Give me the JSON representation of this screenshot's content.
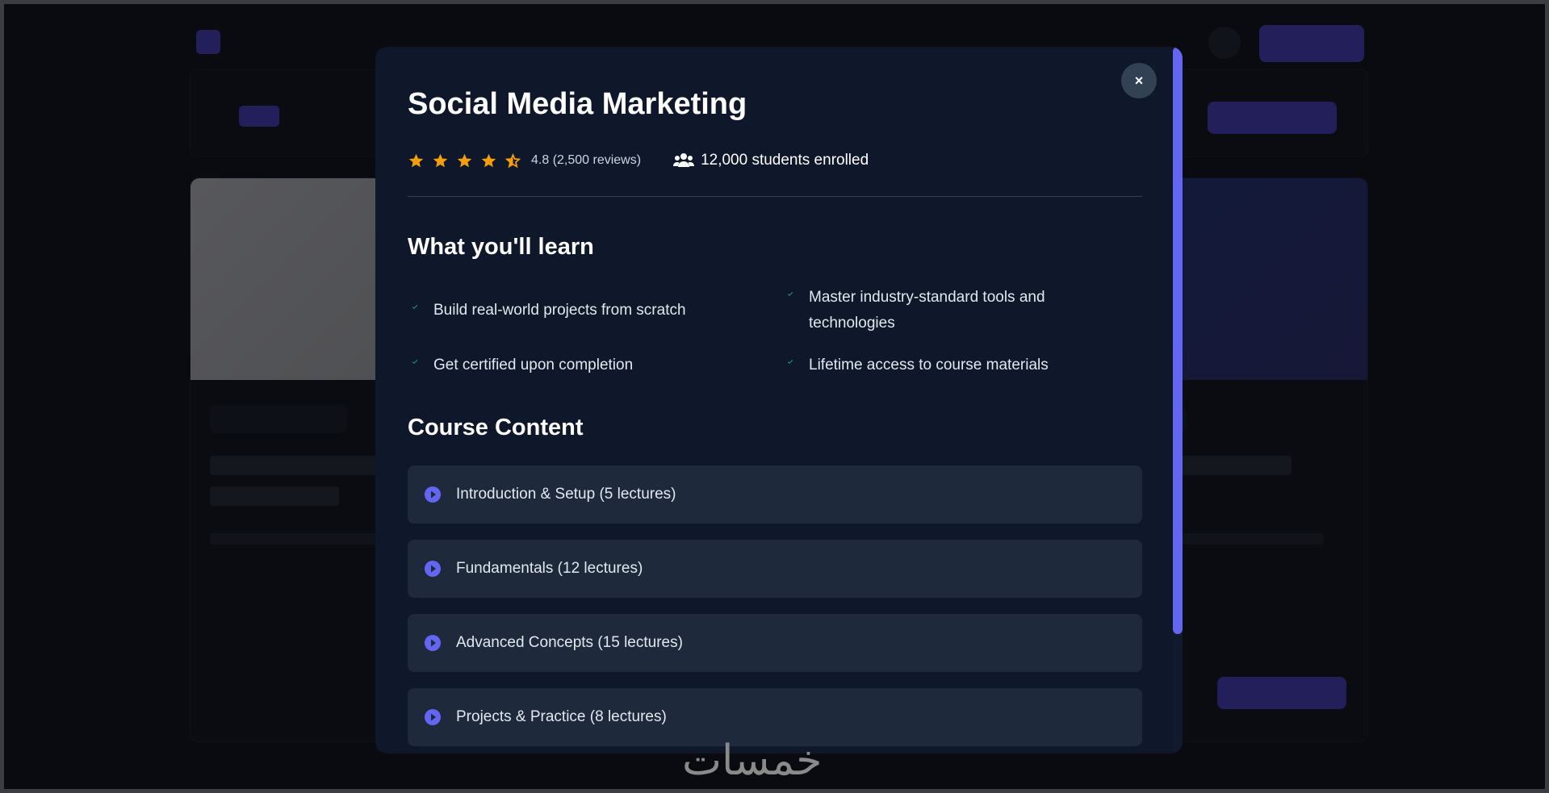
{
  "background": {
    "nav_items": [
      "",
      "",
      "",
      "",
      ""
    ]
  },
  "modal": {
    "title": "Social Media Marketing",
    "rating": {
      "value": 4.8,
      "text": "4.8 (2,500 reviews)",
      "stars_full": 4,
      "stars_half": 1,
      "star_color": "#f59e0b"
    },
    "students_text": "12,000 students enrolled",
    "learn_heading": "What you'll learn",
    "learn_items": [
      "Build real-world projects from scratch",
      "Master industry-standard tools and technologies",
      "Get certified upon completion",
      "Lifetime access to course materials"
    ],
    "content_heading": "Course Content",
    "sections": [
      "Introduction & Setup (5 lectures)",
      "Fundamentals (12 lectures)",
      "Advanced Concepts (15 lectures)",
      "Projects & Practice (8 lectures)"
    ],
    "close_label": "×",
    "accent_color": "#6366f1",
    "check_color": "#14b8a6"
  },
  "watermark": "خمسات"
}
